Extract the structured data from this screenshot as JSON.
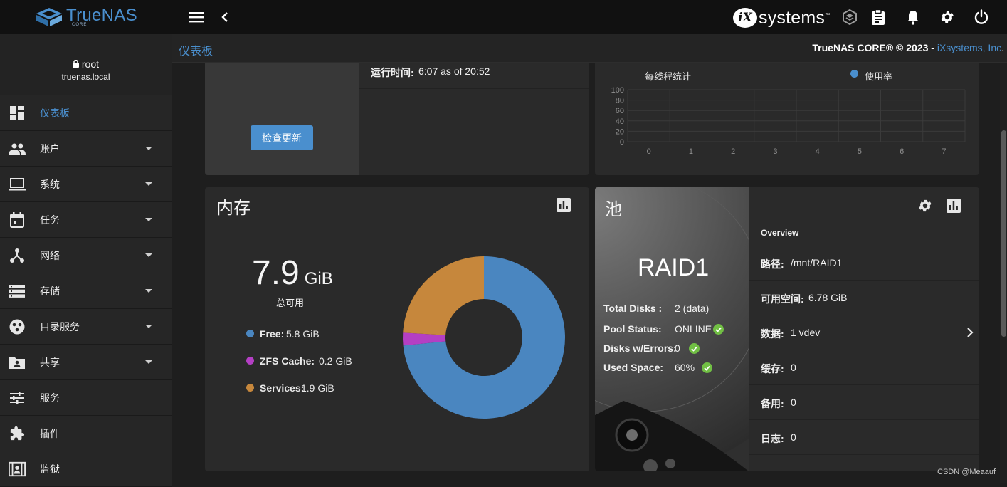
{
  "brand": {
    "name": "TrueNAS",
    "edition": "CORE"
  },
  "topbar": {
    "vendor_logo": "iXsystems",
    "vendor_tm": "™",
    "icons": [
      "menu-icon",
      "chevron-left-icon",
      "truecommand-icon",
      "clipboard-tasks-icon",
      "bell-icon",
      "gear-icon",
      "power-icon"
    ]
  },
  "user": {
    "name": "root",
    "host": "truenas.local"
  },
  "sidebar": {
    "items": [
      {
        "label": "仪表板",
        "icon": "dashboard-icon",
        "active": true,
        "expandable": false
      },
      {
        "label": "账户",
        "icon": "people-icon",
        "expandable": true
      },
      {
        "label": "系统",
        "icon": "laptop-icon",
        "expandable": true
      },
      {
        "label": "任务",
        "icon": "calendar-icon",
        "expandable": true
      },
      {
        "label": "网络",
        "icon": "network-icon",
        "expandable": true
      },
      {
        "label": "存储",
        "icon": "storage-icon",
        "expandable": true
      },
      {
        "label": "目录服务",
        "icon": "directory-icon",
        "expandable": true
      },
      {
        "label": "共享",
        "icon": "shared-folder-icon",
        "expandable": true
      },
      {
        "label": "服务",
        "icon": "tune-icon",
        "expandable": false
      },
      {
        "label": "插件",
        "icon": "puzzle-icon",
        "expandable": false
      },
      {
        "label": "监狱",
        "icon": "jail-icon",
        "expandable": false
      }
    ]
  },
  "breadcrumb": {
    "current": "仪表板",
    "copyright": "TrueNAS CORE® © 2023 - ",
    "vendor_link": "iXsystems, Inc",
    "suffix": "."
  },
  "sysinfo": {
    "uptime_label": "运行时间:",
    "uptime_value": "6:07 as of 20:52",
    "check_updates_button": "检查更新"
  },
  "cpu": {
    "chart_title": "每线程统计",
    "legend_label": "使用率",
    "legend_color": "#4a8fce",
    "y_ticks": [
      "100",
      "80",
      "60",
      "40",
      "20",
      "0"
    ],
    "x_ticks": [
      "0",
      "1",
      "2",
      "3",
      "4",
      "5",
      "6",
      "7"
    ]
  },
  "memory": {
    "title": "内存",
    "total_value": "7.9",
    "total_unit": "GiB",
    "total_caption": "总可用",
    "legend": [
      {
        "label": "Free:",
        "value": "5.8 GiB",
        "color": "#4a86c0"
      },
      {
        "label": "ZFS Cache:",
        "value": "0.2 GiB",
        "color": "#b43fc4"
      },
      {
        "label": "Services:",
        "value": "1.9 GiB",
        "color": "#c6873c"
      }
    ]
  },
  "chart_data": {
    "type": "pie",
    "title": "",
    "categories": [
      "Free",
      "ZFS Cache",
      "Services"
    ],
    "values": [
      5.8,
      0.2,
      1.9
    ],
    "colors": [
      "#4a86c0",
      "#b43fc4",
      "#c6873c"
    ],
    "unit": "GiB",
    "donut": true
  },
  "pool": {
    "title": "池",
    "name": "RAID1",
    "stats": [
      {
        "label": "Total Disks :",
        "value": "2 (data)",
        "ok": false
      },
      {
        "label": "Pool Status:",
        "value": "ONLINE",
        "ok": true
      },
      {
        "label": "Disks w/Errors:",
        "value": "0",
        "ok": true
      },
      {
        "label": "Used Space:",
        "value": "60%",
        "ok": true
      }
    ],
    "overview_heading": "Overview",
    "overview": [
      {
        "key": "路径:",
        "value": "/mnt/RAID1"
      },
      {
        "key": "可用空间:",
        "value": "6.78 GiB"
      },
      {
        "key": "数据:",
        "value": "1 vdev",
        "has_arrow": true
      },
      {
        "key": "缓存:",
        "value": "0"
      },
      {
        "key": "备用:",
        "value": "0"
      },
      {
        "key": "日志:",
        "value": "0"
      }
    ]
  },
  "watermark": "CSDN @Meaauf"
}
